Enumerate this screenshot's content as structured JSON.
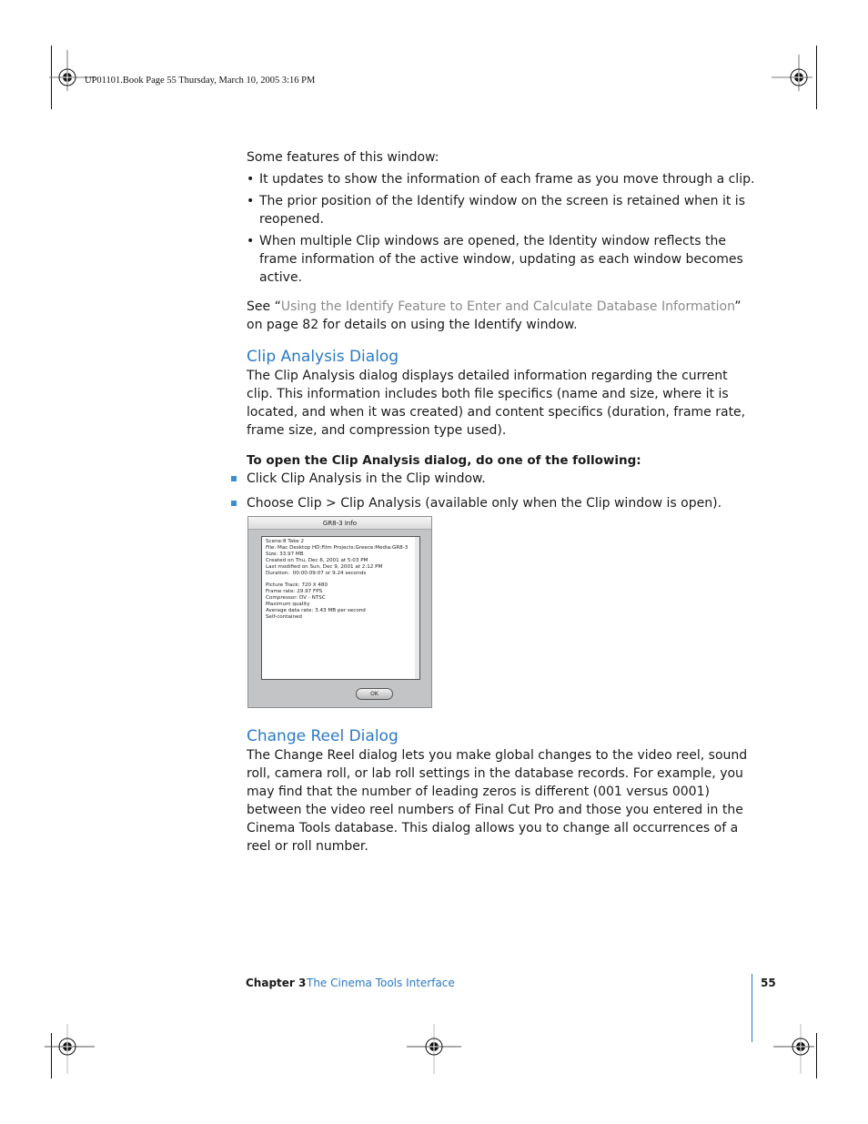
{
  "slug": "UP01101.Book  Page 55  Thursday, March 10, 2005  3:16 PM",
  "intro": "Some features of this window:",
  "features": [
    "It updates to show the information of each frame as you move through a clip.",
    "The prior position of the Identify window on the screen is retained when it is reopened.",
    "When multiple Clip windows are opened, the Identity window reflects the frame information of the active window, updating as each window becomes active."
  ],
  "see": {
    "prefix": "See “",
    "link": "Using the Identify Feature to Enter and Calculate Database Information",
    "suffix": "” on page 82 for details on using the Identify window."
  },
  "clip_analysis": {
    "heading": "Clip Analysis Dialog",
    "body": "The Clip Analysis dialog displays detailed information regarding the current clip. This information includes both file specifics (name and size, where it is located, and when it was created) and content specifics (duration, frame rate, frame size, and compression type used).",
    "instruction": "To open the Clip Analysis dialog, do one of the following:",
    "steps": [
      "Click Clip Analysis in the Clip window.",
      "Choose Clip > Clip Analysis (available only when the Clip window is open)."
    ]
  },
  "dialog": {
    "title": "GR8-3 Info",
    "text": "Scene:8 Take 2\nFile: Mac Desktop HD:Film Projects:Greece:Media:GR8-3\nSize: 33.97 MB\nCreated on Thu, Dec 6, 2001 at 5:03 PM\nLast modified on Sun, Dec 9, 2001 at 2:12 PM\nDuration:  00:00:09:07 or 9.24 seconds\n\nPicture Track: 720 X 480\nFrame rate: 29.97 FPS\nCompressor: DV - NTSC\nMaximum quality\nAverage data rate: 3.43 MB per second\nSelf-contained",
    "ok_label": "OK"
  },
  "change_reel": {
    "heading": "Change Reel Dialog",
    "body": "The Change Reel dialog lets you make global changes to the video reel, sound roll, camera roll, or lab roll settings in the database records. For example, you may find that the number of leading zeros is different (001 versus 0001) between the video reel numbers of Final Cut Pro and those you entered in the Cinema Tools database. This dialog allows you to change all occurrences of a reel or roll number."
  },
  "footer": {
    "chapter": "Chapter 3",
    "title": "The Cinema Tools Interface",
    "page": "55"
  },
  "colors": {
    "accent": "#2a7ac4",
    "link": "#8a8a8a"
  }
}
